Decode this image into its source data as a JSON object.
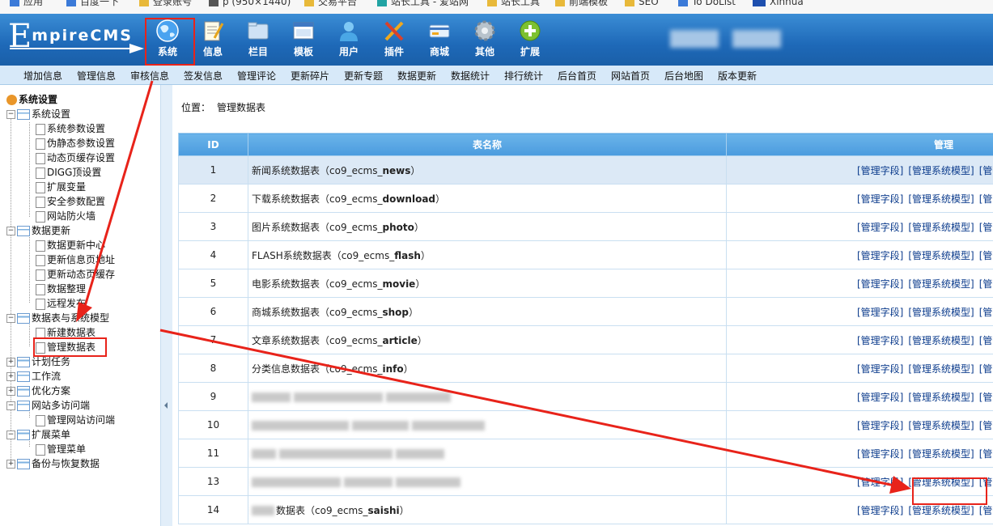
{
  "bookmarks": [
    "应用",
    "百度一下",
    "登录账号",
    "p (950×1440)",
    "交易平台",
    "站长工具 - 爱站网",
    "站长工具",
    "前端模板",
    "SEO",
    "To DoList",
    "Xinhua"
  ],
  "header": {
    "logo": {
      "first_letter": "E",
      "rest": "mpireCMS"
    },
    "nav": [
      {
        "key": "system",
        "label": "系统",
        "icon": "globe-icon"
      },
      {
        "key": "info",
        "label": "信息",
        "icon": "notepad-icon"
      },
      {
        "key": "column",
        "label": "栏目",
        "icon": "folder-icon"
      },
      {
        "key": "template",
        "label": "模板",
        "icon": "window-icon"
      },
      {
        "key": "user",
        "label": "用户",
        "icon": "user-icon"
      },
      {
        "key": "plugin",
        "label": "插件",
        "icon": "tools-icon"
      },
      {
        "key": "shop",
        "label": "商城",
        "icon": "card-icon"
      },
      {
        "key": "other",
        "label": "其他",
        "icon": "gear-icon"
      },
      {
        "key": "extend",
        "label": "扩展",
        "icon": "plus-circle-icon"
      }
    ]
  },
  "submenu": [
    "增加信息",
    "管理信息",
    "审核信息",
    "签发信息",
    "管理评论",
    "更新碎片",
    "更新专题",
    "数据更新",
    "数据统计",
    "排行统计",
    "后台首页",
    "网站首页",
    "后台地图",
    "版本更新"
  ],
  "sidebar": {
    "root": "系统设置",
    "groups": [
      {
        "label": "系统设置",
        "expanded": true,
        "items": [
          "系统参数设置",
          "伪静态参数设置",
          "动态页缓存设置",
          "DIGG顶设置",
          "扩展变量",
          "安全参数配置",
          "网站防火墙"
        ]
      },
      {
        "label": "数据更新",
        "expanded": true,
        "items": [
          "数据更新中心",
          "更新信息页地址",
          "更新动态页缓存",
          "数据整理",
          "远程发布"
        ]
      },
      {
        "label": "数据表与系统模型",
        "expanded": true,
        "items": [
          "新建数据表",
          "管理数据表"
        ]
      },
      {
        "label": "计划任务",
        "expanded": false,
        "items": []
      },
      {
        "label": "工作流",
        "expanded": false,
        "items": []
      },
      {
        "label": "优化方案",
        "expanded": false,
        "items": []
      },
      {
        "label": "网站多访问端",
        "expanded": true,
        "items": [
          "管理网站访问端"
        ]
      },
      {
        "label": "扩展菜单",
        "expanded": true,
        "items": [
          "管理菜单"
        ]
      },
      {
        "label": "备份与恢复数据",
        "expanded": false,
        "items": []
      }
    ]
  },
  "location": {
    "label": "位置：",
    "crumb": "管理数据表"
  },
  "table": {
    "headers": [
      "ID",
      "表名称",
      "管理"
    ],
    "actions": [
      "[管理字段]",
      "[管理系统模型]",
      "[管"
    ],
    "rows": [
      {
        "id": "1",
        "prefix": "新闻系统数据表（co9_ecms_",
        "suffix": "news",
        "end": "）",
        "blurred": false
      },
      {
        "id": "2",
        "prefix": "下载系统数据表（co9_ecms_",
        "suffix": "download",
        "end": "）",
        "blurred": false
      },
      {
        "id": "3",
        "prefix": "图片系统数据表（co9_ecms_",
        "suffix": "photo",
        "end": "）",
        "blurred": false
      },
      {
        "id": "4",
        "prefix": "FLASH系统数据表（co9_ecms_",
        "suffix": "flash",
        "end": "）",
        "blurred": false
      },
      {
        "id": "5",
        "prefix": "电影系统数据表（co9_ecms_",
        "suffix": "movie",
        "end": "）",
        "blurred": false
      },
      {
        "id": "6",
        "prefix": "商城系统数据表（co9_ecms_",
        "suffix": "shop",
        "end": "）",
        "blurred": false
      },
      {
        "id": "7",
        "prefix": "文章系统数据表（co9_ecms_",
        "suffix": "article",
        "end": "）",
        "blurred": false
      },
      {
        "id": "8",
        "prefix": "分类信息数据表（co9_ecms_",
        "suffix": "info",
        "end": "）",
        "blurred": false
      },
      {
        "id": "9",
        "prefix": "",
        "suffix": "",
        "end": "",
        "blurred": true
      },
      {
        "id": "10",
        "prefix": "",
        "suffix": "",
        "end": "",
        "blurred": true
      },
      {
        "id": "11",
        "prefix": "",
        "suffix": "",
        "end": "",
        "blurred": true
      },
      {
        "id": "13",
        "prefix": "",
        "suffix": "",
        "end": "",
        "blurred": true
      },
      {
        "id": "14",
        "prefix": "数据表（co9_ecms_",
        "suffix": "saishi",
        "end": "）",
        "blurred": false
      }
    ]
  },
  "colors": {
    "header": "#1e69b8",
    "annotation": "#e8231a",
    "link": "#0b3b8c"
  }
}
